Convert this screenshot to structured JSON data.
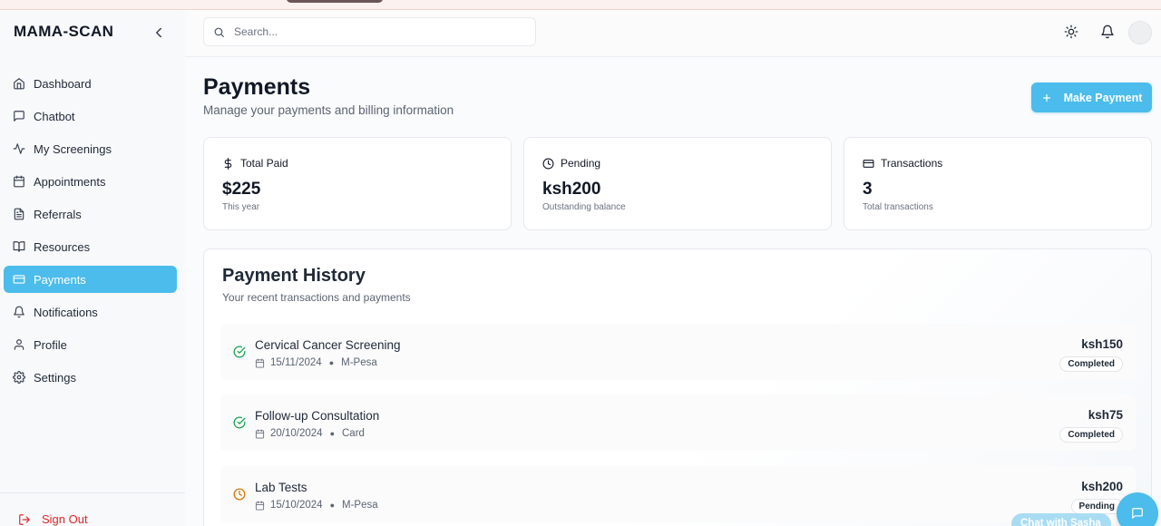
{
  "app": {
    "brand": "MAMA-SCAN"
  },
  "sidebar": {
    "items": [
      {
        "label": "Dashboard",
        "icon": "home-icon"
      },
      {
        "label": "Chatbot",
        "icon": "message-square-icon"
      },
      {
        "label": "My Screenings",
        "icon": "activity-icon"
      },
      {
        "label": "Appointments",
        "icon": "calendar-icon"
      },
      {
        "label": "Referrals",
        "icon": "file-text-icon"
      },
      {
        "label": "Resources",
        "icon": "book-open-icon"
      },
      {
        "label": "Payments",
        "icon": "credit-card-icon",
        "active": true
      },
      {
        "label": "Notifications",
        "icon": "bell-icon"
      },
      {
        "label": "Profile",
        "icon": "user-icon"
      },
      {
        "label": "Settings",
        "icon": "gear-icon"
      }
    ],
    "sign_out": "Sign Out"
  },
  "header": {
    "search_placeholder": "Search..."
  },
  "page": {
    "title": "Payments",
    "subtitle": "Manage your payments and billing information",
    "make_payment_label": "Make Payment"
  },
  "stats": [
    {
      "label": "Total Paid",
      "value": "$225",
      "sub": "This year",
      "icon": "dollar-icon"
    },
    {
      "label": "Pending",
      "value": "ksh200",
      "sub": "Outstanding balance",
      "icon": "clock-icon"
    },
    {
      "label": "Transactions",
      "value": "3",
      "sub": "Total transactions",
      "icon": "credit-card-icon"
    }
  ],
  "history": {
    "title": "Payment History",
    "subtitle": "Your recent transactions and payments",
    "transactions": [
      {
        "name": "Cervical Cancer Screening",
        "date": "15/11/2024",
        "method": "M-Pesa",
        "amount": "ksh150",
        "status": "Completed"
      },
      {
        "name": "Follow-up Consultation",
        "date": "20/10/2024",
        "method": "Card",
        "amount": "ksh75",
        "status": "Completed"
      },
      {
        "name": "Lab Tests",
        "date": "15/10/2024",
        "method": "M-Pesa",
        "amount": "ksh200",
        "status": "Pending"
      }
    ]
  },
  "chat": {
    "label": "Chat with Sasha"
  },
  "colors": {
    "accent": "#4bbcec",
    "success": "#16a34a",
    "pending": "#d97706",
    "danger": "#dc2626"
  }
}
